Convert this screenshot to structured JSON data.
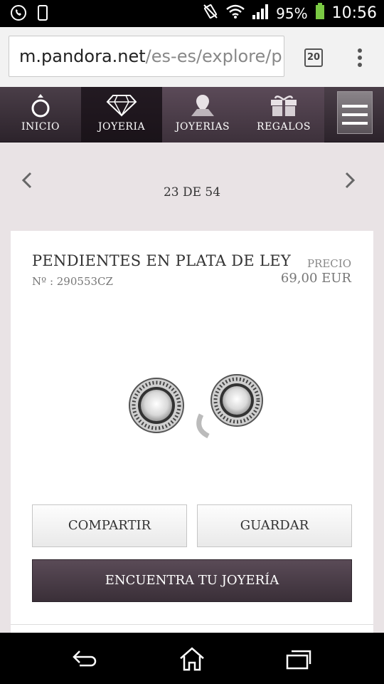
{
  "status_bar": {
    "battery": "95%",
    "time": "10:56"
  },
  "browser": {
    "url_host": "m.pandora.net",
    "url_path": "/es-es/explore/p",
    "tab_count": "20"
  },
  "nav": {
    "items": [
      {
        "label": "INICIO"
      },
      {
        "label": "JOYERIA"
      },
      {
        "label": "JOYERIAS"
      },
      {
        "label": "REGALOS"
      }
    ]
  },
  "pager": {
    "counter": "23 DE 54"
  },
  "product": {
    "title": "PENDIENTES EN PLATA DE LEY",
    "ref": "Nº : 290553CZ",
    "price_label": "PRECIO",
    "price": "69,00 EUR"
  },
  "actions": {
    "share": "COMPARTIR",
    "save": "GUARDAR",
    "find": "ENCUENTRA TU JOYERÍA"
  }
}
